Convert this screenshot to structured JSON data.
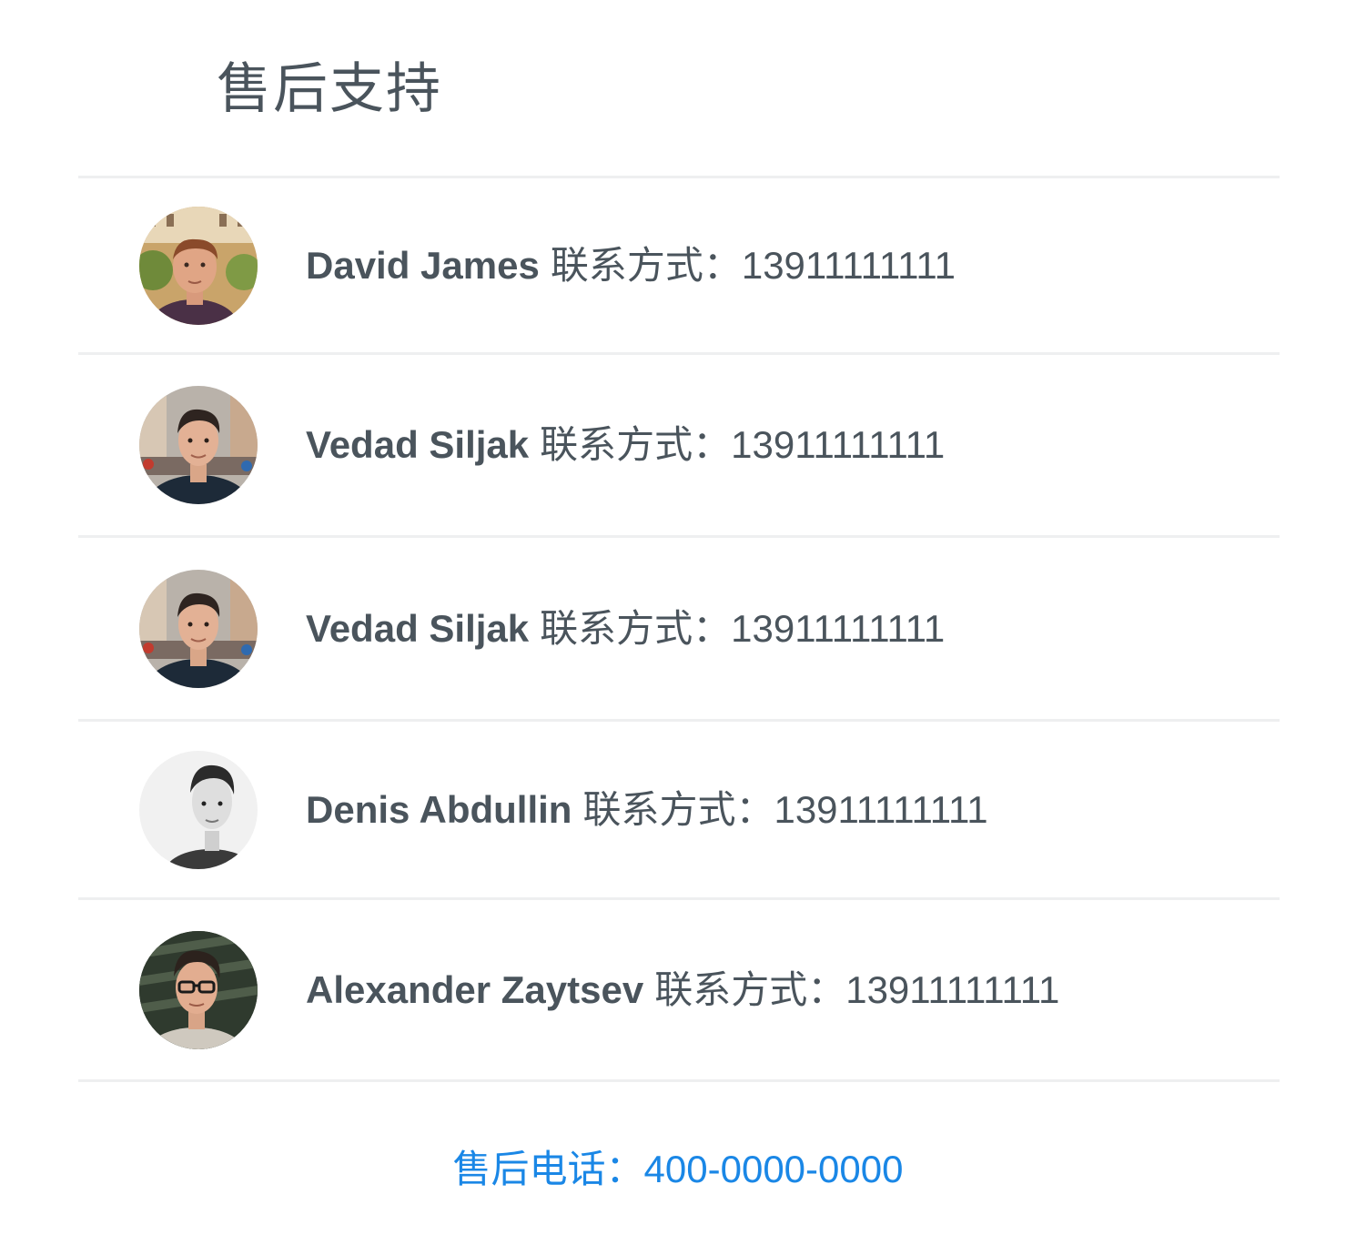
{
  "page": {
    "title": "售后支持"
  },
  "contacts": [
    {
      "name": "David James",
      "label": "联系方式：",
      "phone": "13911111111",
      "avatar_icon": "person-photo-icon"
    },
    {
      "name": "Vedad Siljak",
      "label": "联系方式：",
      "phone": "13911111111",
      "avatar_icon": "person-photo-icon"
    },
    {
      "name": "Vedad Siljak",
      "label": "联系方式：",
      "phone": "13911111111",
      "avatar_icon": "person-photo-icon"
    },
    {
      "name": "Denis Abdullin",
      "label": "联系方式：",
      "phone": "13911111111",
      "avatar_icon": "person-photo-icon"
    },
    {
      "name": "Alexander Zaytsev",
      "label": "联系方式：",
      "phone": "13911111111",
      "avatar_icon": "person-photo-icon"
    }
  ],
  "footer": {
    "hotline_label": "售后电话：",
    "hotline_number": "400-0000-0000"
  },
  "colors": {
    "text": "#4a545c",
    "divider": "#eeeff0",
    "link": "#1a87e6",
    "background": "#ffffff"
  }
}
